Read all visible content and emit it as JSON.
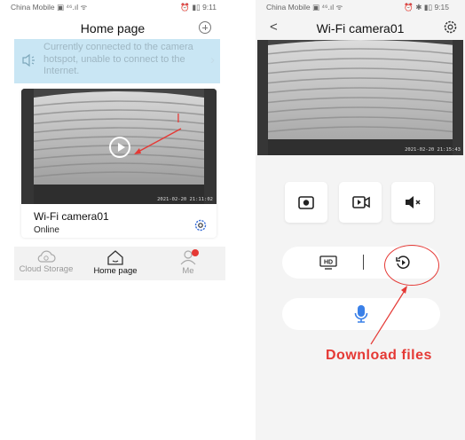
{
  "left": {
    "status_bar": {
      "carrier": "China Mobile ▣ ⁴⁶.ıl ᯤ",
      "right": "⏰ ▮▯ 9:11"
    },
    "title": "Home page",
    "banner": {
      "text": "Currently connected to the camera hotspot, unable to connect to the Internet.",
      "chevron": "›"
    },
    "camera_card": {
      "name": "Wi-Fi camera01",
      "status": "Online",
      "timestamp": "2021-02-20 21:11:02"
    },
    "tabs": [
      {
        "label": "Cloud Storage",
        "icon": "cloud-icon",
        "active": false
      },
      {
        "label": "Home page",
        "icon": "home-icon",
        "active": true
      },
      {
        "label": "Me",
        "icon": "person-icon",
        "active": false
      }
    ]
  },
  "right": {
    "status_bar": {
      "carrier": "China Mobile ▣ ⁴⁶.ıl ᯤ",
      "right": "⏰ ✱ ▮▯ 9:15"
    },
    "back": "<",
    "title": "Wi-Fi camera01",
    "timestamp": "2021-02-20 21:15:43",
    "controls": {
      "snapshot_icon": "camera-icon",
      "record_icon": "video-record-icon",
      "mute_icon": "speaker-mute-icon",
      "quality_badge": "HD",
      "playback_icon": "playback-icon",
      "mic_icon": "microphone-icon"
    }
  },
  "annotation": {
    "label": "Download files"
  },
  "colors": {
    "banner_bg": "#c9e6f4",
    "annotation_red": "#e53935",
    "mic_blue": "#3a80e8",
    "tabbar_bg": "#f2f2f2",
    "right_bg": "#f4f4f4"
  }
}
